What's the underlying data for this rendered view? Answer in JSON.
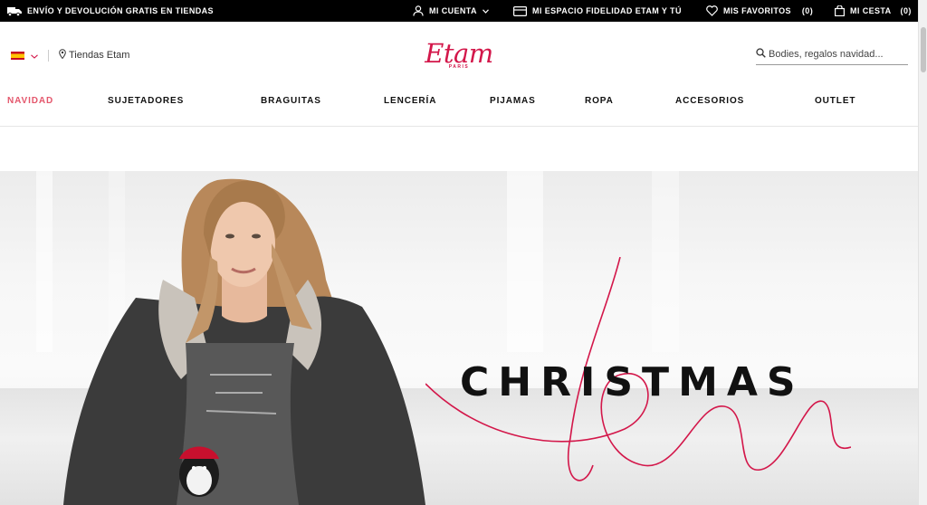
{
  "topbar": {
    "shipping": "ENVÍO Y DEVOLUCIÓN GRATIS EN TIENDAS",
    "account": "MI CUENTA",
    "fidelity": "MI ESPACIO FIDELIDAD ETAM Y TÚ",
    "favorites": "MIS FAVORITOS",
    "favorites_count": "(0)",
    "cart": "MI CESTA",
    "cart_count": "(0)"
  },
  "header": {
    "stores": "Tiendas Etam",
    "logo": "Etam",
    "logo_sub": "PARIS",
    "search_placeholder": "Bodies, regalos navidad..."
  },
  "nav": {
    "items": [
      "NAVIDAD",
      "SUJETADORES",
      "BRAGUITAS",
      "LENCERÍA",
      "PIJAMAS",
      "ROPA",
      "ACCESORIOS",
      "OUTLET"
    ],
    "active": "NAVIDAD"
  },
  "hero": {
    "headline": "CHRISTMAS",
    "script_word": "fever"
  },
  "colors": {
    "brand": "#d3174a",
    "nav_active": "#e4576c",
    "topbar_bg": "#000000"
  },
  "icons": [
    "truck-icon",
    "user-icon",
    "card-icon",
    "heart-icon",
    "bag-icon",
    "chevron-down-icon",
    "pin-icon",
    "search-icon",
    "flag-es-icon"
  ]
}
